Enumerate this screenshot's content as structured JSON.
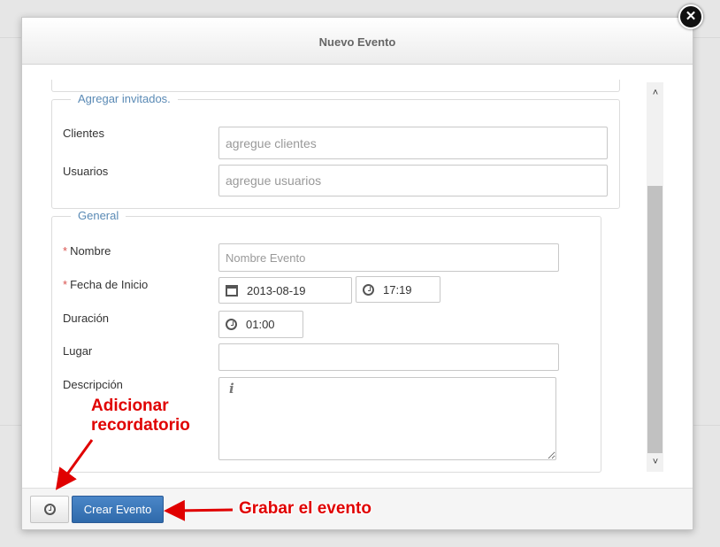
{
  "dialog": {
    "title": "Nuevo Evento",
    "close_symbol": "✕"
  },
  "guests": {
    "legend": "Agregar invitados.",
    "clients_label": "Clientes",
    "clients_placeholder": "agregue clientes",
    "users_label": "Usuarios",
    "users_placeholder": "agregue usuarios"
  },
  "general": {
    "legend": "General",
    "name_label": "Nombre",
    "name_placeholder": "Nombre Evento",
    "start_label": "Fecha de Inicio",
    "start_date": "2013-08-19",
    "start_time": "17:19",
    "duration_label": "Duración",
    "duration": "01:00",
    "place_label": "Lugar",
    "place_value": "",
    "description_label": "Descripción",
    "description_value": "",
    "required_mark": "*"
  },
  "footer": {
    "create_label": "Crear Evento"
  },
  "annotations": {
    "reminder_line1": "Adicionar",
    "reminder_line2": "recordatorio",
    "save": "Grabar el evento"
  },
  "icons": {
    "close": "close-icon",
    "calendar": "calendar-icon",
    "clock": "clock-icon",
    "info": "info-icon"
  },
  "colors": {
    "accent_blue": "#2f6aab",
    "legend": "#5a8ab5",
    "required": "#d9534f",
    "annotation": "#e00000"
  }
}
